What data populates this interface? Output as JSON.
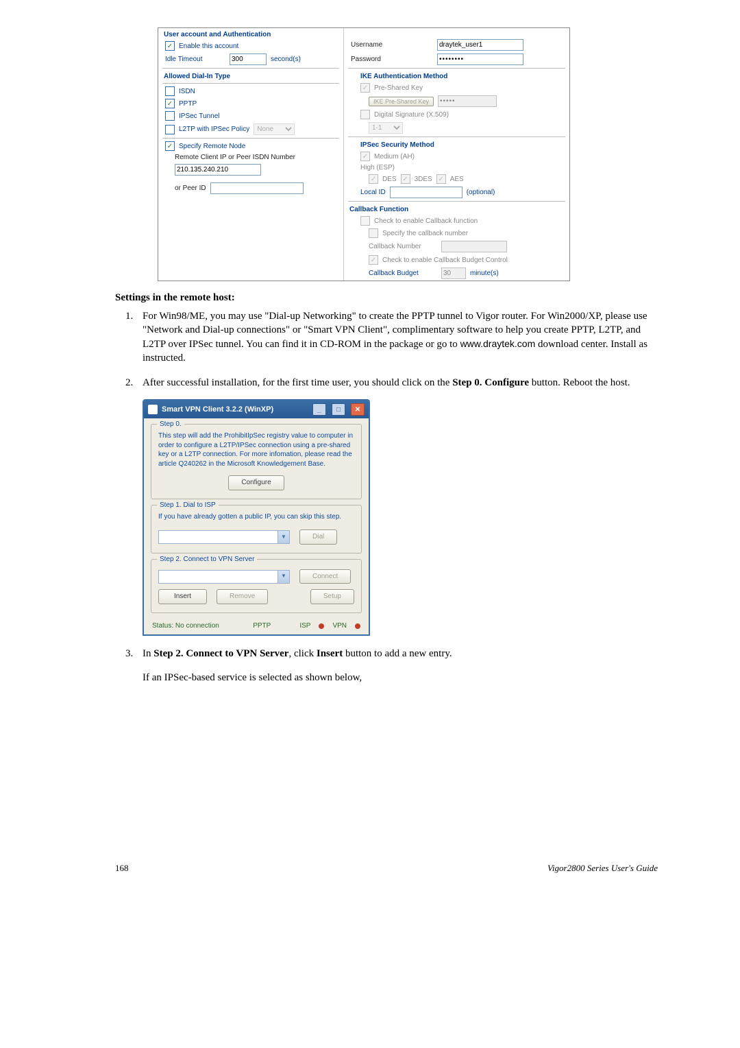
{
  "shot1": {
    "left": {
      "section1_title": "User account and Authentication",
      "enable_account": "Enable this account",
      "idle_timeout_label": "Idle Timeout",
      "idle_timeout_value": "300",
      "idle_timeout_unit": "second(s)",
      "section2_title": "Allowed Dial-In Type",
      "isdn": "ISDN",
      "pptp": "PPTP",
      "ipsec_tunnel": "IPSec Tunnel",
      "l2tp_label": "L2TP with IPSec Policy",
      "l2tp_select": "None",
      "specify_remote": "Specify Remote Node",
      "remote_client_label": "Remote Client IP or Peer ISDN Number",
      "remote_client_value": "210.135.240.210",
      "or_peer_id": "or Peer ID"
    },
    "right": {
      "username_label": "Username",
      "username_value": "draytek_user1",
      "password_label": "Password",
      "password_value": "••••••••",
      "ike_title": "IKE Authentication Method",
      "psk": "Pre-Shared Key",
      "ike_psk_btn": "IKE Pre-Shared Key",
      "ike_psk_value": "•••••",
      "dsig": "Digital Signature (X.509)",
      "dsig_select": "1-1",
      "ipsec_sec_title": "IPSec Security Method",
      "medium": "Medium (AH)",
      "high": "High (ESP)",
      "des": "DES",
      "tdes": "3DES",
      "aes": "AES",
      "local_id": "Local ID",
      "optional": "(optional)",
      "cb_title": "Callback Function",
      "cb_enable": "Check to enable Callback function",
      "cb_specify": "Specify the callback number",
      "cb_number": "Callback Number",
      "cb_budget_ctrl": "Check to enable Callback Budget Control",
      "cb_budget": "Callback Budget",
      "cb_budget_value": "30",
      "cb_budget_unit": "minute(s)"
    }
  },
  "text": {
    "settings_heading": "Settings in the remote host:",
    "step1": "For Win98/ME, you may use \"Dial-up Networking\" to create the PPTP tunnel to Vigor router. For Win2000/XP, please use \"Network and Dial-up connections\" or \"Smart VPN Client\", complimentary software to help you create PPTP, L2TP, and L2TP over IPSec tunnel. You can find it in CD-ROM in the package or go to ",
    "step1_url": "www.draytek.com",
    "step1_tail": " download center. Install as instructed.",
    "step2a": "After successful installation, for the first time user, you should click on the ",
    "step2b": "Step 0. Configure",
    "step2c": " button. Reboot the host.",
    "step3a": "In ",
    "step3b": "Step 2. Connect to VPN Server",
    "step3c": ", click ",
    "step3d": "Insert",
    "step3e": " button to add a new entry.",
    "step3_after": "If an IPSec-based service is selected as shown below,"
  },
  "shot2": {
    "title": "Smart VPN Client  3.2.2 (WinXP)",
    "step0_title": "Step 0.",
    "step0_text": "This step will add the ProhibitIpSec registry value to computer in order to configure a L2TP/IPSec connection using a pre-shared key or a L2TP connection. For more infomation, please read the article Q240262 in the Microsoft Knowledgement Base.",
    "configure_btn": "Configure",
    "step1_title": "Step 1. Dial to ISP",
    "step1_text": "If you have already gotten a public IP, you can skip this step.",
    "dial_btn": "Dial",
    "step2_title": "Step 2. Connect to VPN Server",
    "connect_btn": "Connect",
    "insert_btn": "Insert",
    "remove_btn": "Remove",
    "setup_btn": "Setup",
    "status": "Status: No connection",
    "proto": "PPTP",
    "isp": "ISP",
    "vpn": "VPN"
  },
  "footer": {
    "page": "168",
    "guide": "Vigor2800  Series  User's  Guide"
  }
}
